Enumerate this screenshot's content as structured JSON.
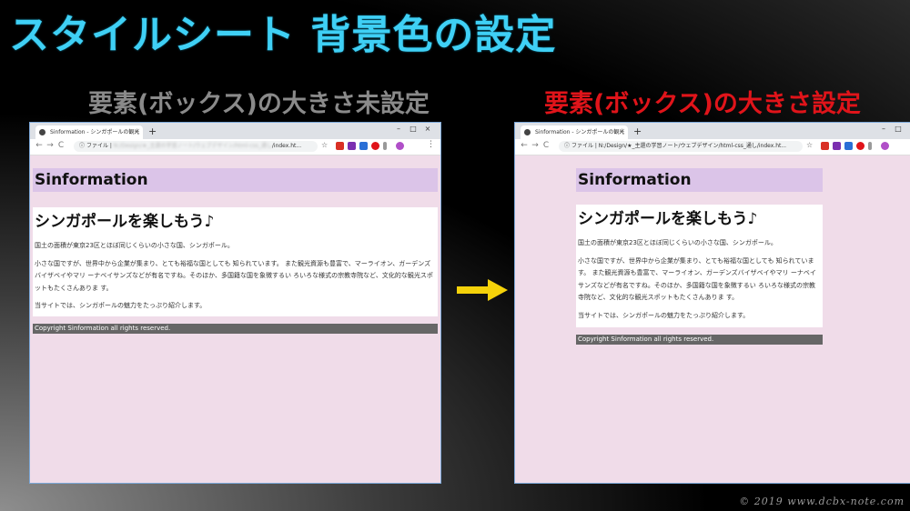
{
  "slide": {
    "title": "スタイルシート 背景色の設定",
    "left_label": "要素(ボックス)の大きさ未設定",
    "right_label": "要素(ボックス)の大きさ設定",
    "watermark": "© 2019 www.dcbx-note.com"
  },
  "colors": {
    "title": "#3fd0f5",
    "left_label": "#8a8a8a",
    "right_label": "#e0141a",
    "page_bg": "#f0dce9",
    "header_bg": "#dbc4e8",
    "footer_bg": "#666666",
    "arrow": "#f5d20a"
  },
  "browser": {
    "tab_title": "Sinformation - シンガポールの観光",
    "tab_close": "×",
    "new_tab": "+",
    "min": "–",
    "max": "□",
    "close": "×",
    "back": "←",
    "forward": "→",
    "reload": "C",
    "info": "ⓘ",
    "file_label": "ファイル",
    "left_url_blurred": "N:/Design/★_主還の学習ノート/ウェブデザイン/html-css_通し",
    "left_url_tail": "/index.ht...",
    "right_url": "N:/Design/★_主還の学習ノート/ウェブデザイン/html-css_通し/index.ht...",
    "star": "☆",
    "menu": "⋮"
  },
  "page": {
    "header": "Sinformation",
    "heading": "シンガポールを楽しもう♪",
    "p1": "国土の面積が東京23区とほぼ同じくらいの小さな国、シンガポール。",
    "p2": "小さな国ですが、世界中から企業が集まり、とても裕福な国としても 知られています。 また観光資源も豊富で、マーライオン、ガーデンズバイザベイやマリ ーナベイサンズなどが有名ですね。そのほか、多国籍な国を象徴するい ろいろな様式の宗教寺院など、文化的な観光スポットもたくさんありま す。",
    "p3": "当サイトでは、シンガポールの魅力をたっぷり紹介します。",
    "footer": "Copyright Sinformation all rights reserved."
  }
}
